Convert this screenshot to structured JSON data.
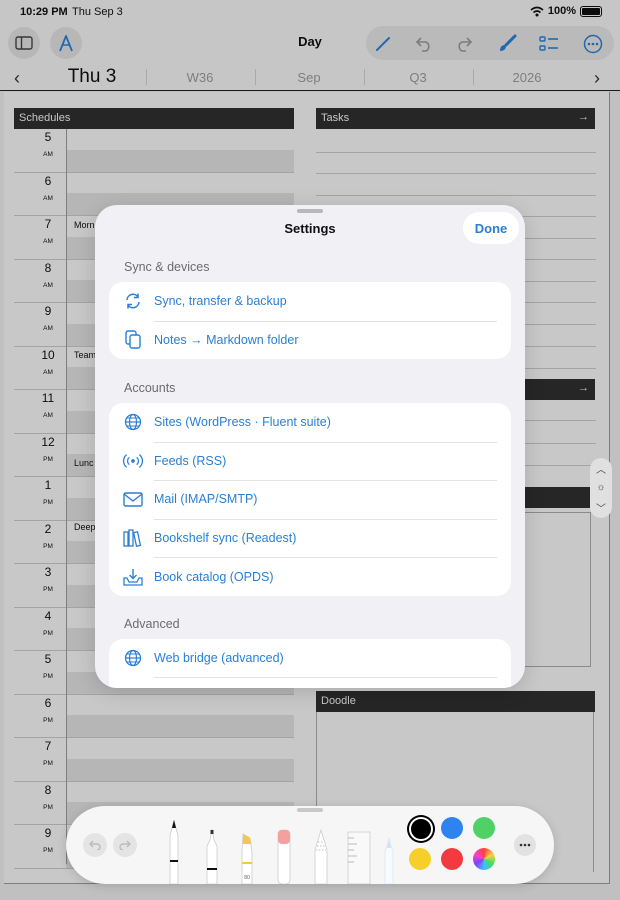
{
  "status_bar": {
    "time": "10:29 PM",
    "date": "Thu Sep 3",
    "battery": "100%"
  },
  "toolbar": {
    "title": "Day"
  },
  "date_nav": {
    "day": "Thu 3",
    "week": "W36",
    "month": "Sep",
    "quarter": "Q3",
    "year": "2026"
  },
  "page": {
    "schedules_label": "Schedules",
    "tasks_label": "Tasks",
    "tasks_arrow": "→",
    "section2_arrow": "→",
    "doodle_label": "Doodle",
    "hours": [
      {
        "num": "5",
        "ampm": "AM"
      },
      {
        "num": "6",
        "ampm": "AM"
      },
      {
        "num": "7",
        "ampm": "AM"
      },
      {
        "num": "8",
        "ampm": "AM"
      },
      {
        "num": "9",
        "ampm": "AM"
      },
      {
        "num": "10",
        "ampm": "AM"
      },
      {
        "num": "11",
        "ampm": "AM"
      },
      {
        "num": "12",
        "ampm": "PM"
      },
      {
        "num": "1",
        "ampm": "PM"
      },
      {
        "num": "2",
        "ampm": "PM"
      },
      {
        "num": "3",
        "ampm": "PM"
      },
      {
        "num": "4",
        "ampm": "PM"
      },
      {
        "num": "5",
        "ampm": "PM"
      },
      {
        "num": "6",
        "ampm": "PM"
      },
      {
        "num": "7",
        "ampm": "PM"
      },
      {
        "num": "8",
        "ampm": "PM"
      },
      {
        "num": "9",
        "ampm": "PM"
      }
    ],
    "events": [
      "Morn",
      "Team",
      "Lunc",
      "Deep"
    ]
  },
  "settings": {
    "title": "Settings",
    "done_label": "Done",
    "groups": [
      {
        "label": "Sync & devices",
        "items": [
          {
            "label": "Sync, transfer & backup",
            "icon": "sync-icon"
          },
          {
            "label": "Notes → Markdown folder",
            "icon": "copy-icon"
          }
        ]
      },
      {
        "label": "Accounts",
        "items": [
          {
            "label": "Sites (WordPress · Fluent suite)",
            "icon": "globe-icon"
          },
          {
            "label": "Feeds (RSS)",
            "icon": "broadcast-icon"
          },
          {
            "label": "Mail (IMAP/SMTP)",
            "icon": "envelope-icon"
          },
          {
            "label": "Bookshelf sync (Readest)",
            "icon": "books-icon"
          },
          {
            "label": "Book catalog (OPDS)",
            "icon": "tray-download-icon"
          }
        ]
      },
      {
        "label": "Advanced",
        "items": [
          {
            "label": "Web bridge (advanced)",
            "icon": "globe-icon"
          }
        ]
      }
    ]
  },
  "palette": {
    "colors": [
      "#000000",
      "#2d83f0",
      "#4fd165",
      "#f7cf2a",
      "#f23a3f",
      "rainbow"
    ],
    "marker_label": "80"
  },
  "colors": {
    "accent": "#2a7fd4",
    "header_dark": "#2f2f2f"
  }
}
